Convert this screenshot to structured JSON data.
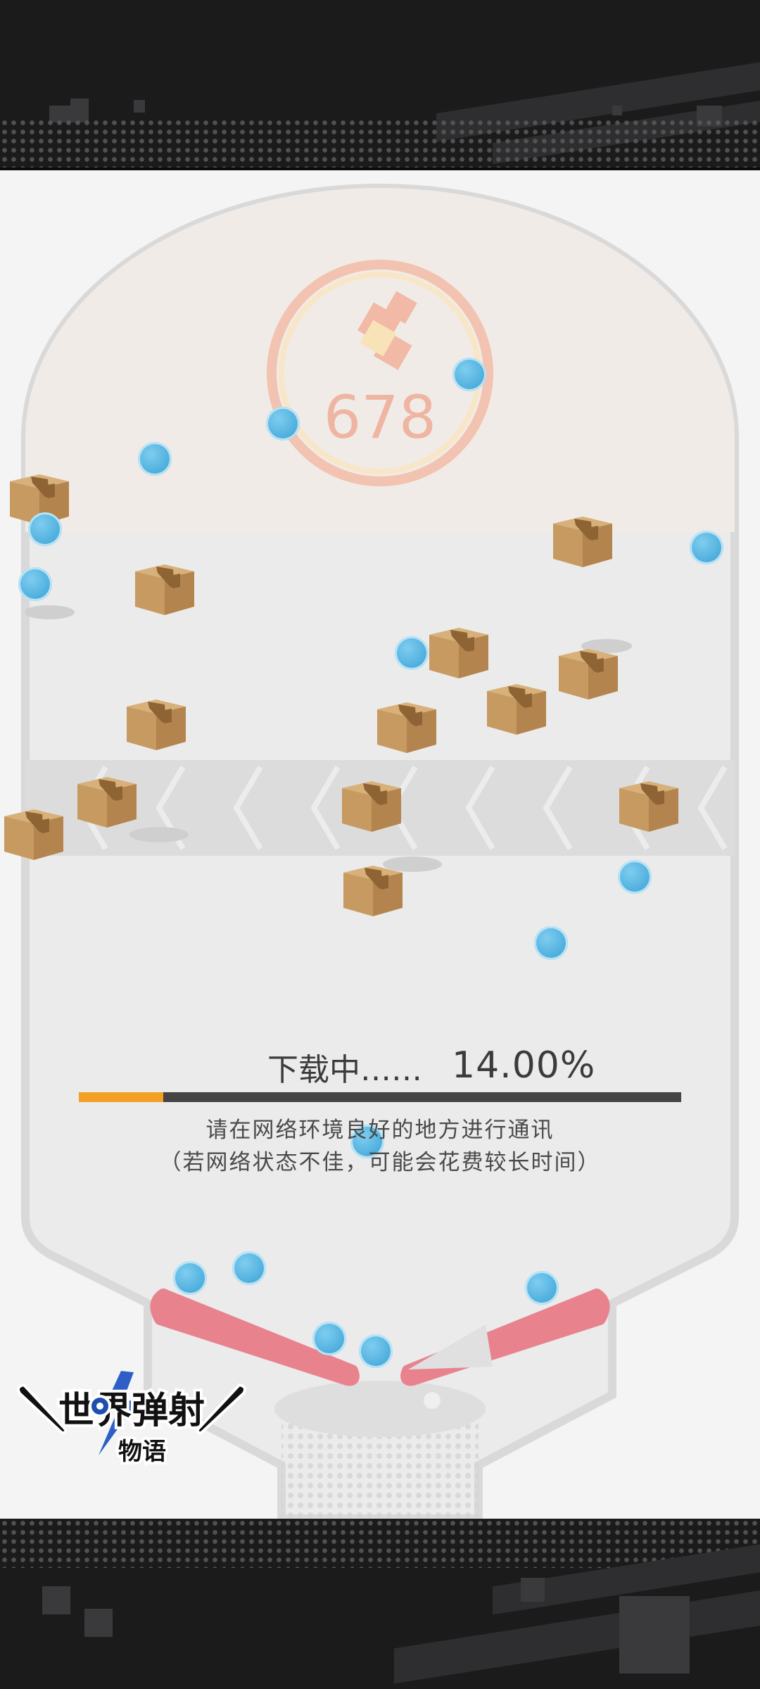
{
  "score_display": {
    "value": "678"
  },
  "loading": {
    "label": "下载中……",
    "progress_text": "14.00%",
    "progress_fraction": 0.14,
    "hint_line1": "请在网络环境良好的地方进行通讯",
    "hint_line2": "（若网络状态不佳，可能会花费较长时间）"
  },
  "logo": {
    "text_main": "世界弹射",
    "text_sub": "物语"
  },
  "colors": {
    "progress_fill": "#f4a023",
    "progress_track": "#444444",
    "ball": "#55b3e0",
    "flipper": "#e8838e",
    "crate": "#c79a62"
  },
  "icons": {
    "bumper": "bumper-target-icon",
    "crate": "cardboard-box-icon",
    "ball": "pinball-ball-icon"
  }
}
